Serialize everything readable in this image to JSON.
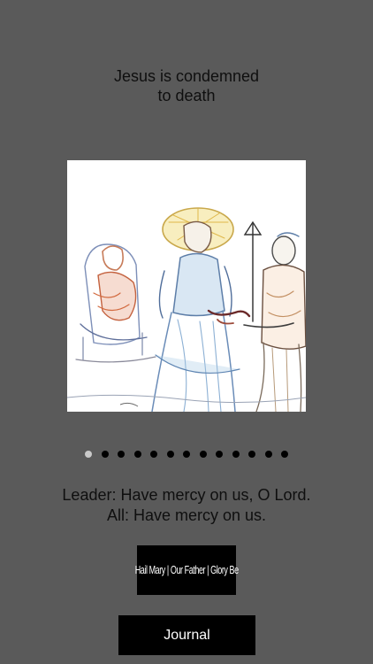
{
  "station": {
    "title_line1": "Jesus is condemned",
    "title_line2": "to death"
  },
  "artwork": {
    "icon": "station-1-sketch-image"
  },
  "pager": {
    "total": 13,
    "current": 1,
    "active_color": "#c9c9c9",
    "inactive_color": "#000000"
  },
  "prayer": {
    "leader_line": "Leader: Have mercy on us, O Lord.",
    "all_line": "All: Have mercy on us."
  },
  "buttons": {
    "prayers_label": "Hail Mary | Our Father | Glory Be",
    "journal_label": "Journal"
  },
  "colors": {
    "background": "#5a5a5a",
    "button_bg": "#000000",
    "button_text": "#ffffff"
  }
}
